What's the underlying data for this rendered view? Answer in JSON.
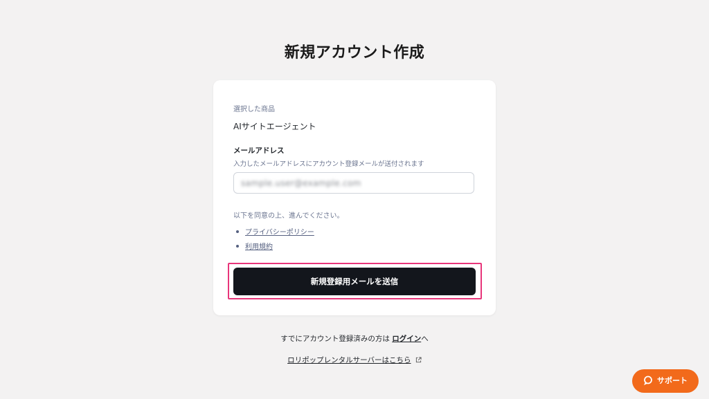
{
  "page": {
    "title": "新規アカウント作成"
  },
  "form": {
    "product_label": "選択した商品",
    "product_name": "AIサイトエージェント",
    "email_label": "メールアドレス",
    "email_help": "入力したメールアドレスにアカウント登録メールが送付されます",
    "email_value": "sample.user@example.com",
    "agree_text": "以下を同意の上、進んでください。",
    "links": [
      {
        "label": "プライバシーポリシー"
      },
      {
        "label": "利用規約"
      }
    ],
    "submit_label": "新規登録用メールを送信"
  },
  "footer": {
    "login_prefix": "すでにアカウント登録済みの方は ",
    "login_link": "ログイン",
    "login_suffix": "へ",
    "lolipop_link": "ロリポップレンタルサーバーはこちら",
    "lolipop_icon": "external-link-icon"
  },
  "support": {
    "label": "サポート",
    "icon": "chat-bubble-icon",
    "color": "#f26a1b"
  },
  "colors": {
    "highlight": "#e8357a",
    "primary_button": "#13161c",
    "background": "#f3f2f2"
  }
}
